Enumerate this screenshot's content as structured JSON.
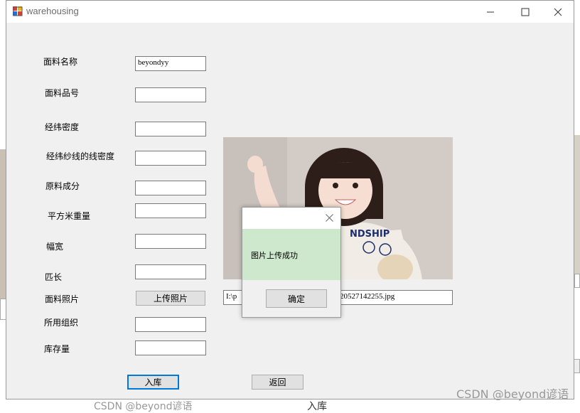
{
  "window": {
    "title": "warehousing",
    "minimize_glyph": "—",
    "maximize_glyph": "☐",
    "close_glyph": "✕"
  },
  "form": {
    "fabric_name_label": "面料名称",
    "fabric_name_value": "beyondyy",
    "fabric_no_label": "面料品号",
    "fabric_no_value": "",
    "warp_weft_density_label": "经纬密度",
    "warp_weft_density_value": "",
    "yarn_density_label": "经纬纱线的线密度",
    "yarn_density_value": "",
    "material_label": "原料成分",
    "material_value": "",
    "weight_label": "平方米重量",
    "weight_value": "",
    "width_label": "幅宽",
    "width_value": "",
    "length_label": "匹长",
    "length_value": "",
    "photo_label": "面料照片",
    "upload_button": "上传照片",
    "organization_label": "所用组织",
    "organization_value": "",
    "stock_label": "库存量",
    "stock_value": "",
    "path_value_left": "I:\\p",
    "path_value_right": "20527142255.jpg",
    "in_stock_button": "入库",
    "back_button": "返回"
  },
  "dialog": {
    "message": "图片上传成功",
    "ok_button": "确定",
    "close_glyph": "✕"
  },
  "background": {
    "watermark": "CSDN @beyond谚语",
    "bottom_left_partial": "CSDN @beyond谚语",
    "bottom_mid_partial": "入库",
    "left_partial": "14",
    "right_partial": "\\W",
    "right_btn_partial": "返"
  },
  "colors": {
    "dialog_body": "#cde8cd",
    "focus_border": "#0078d7",
    "window_bg": "#f0f0f0"
  }
}
